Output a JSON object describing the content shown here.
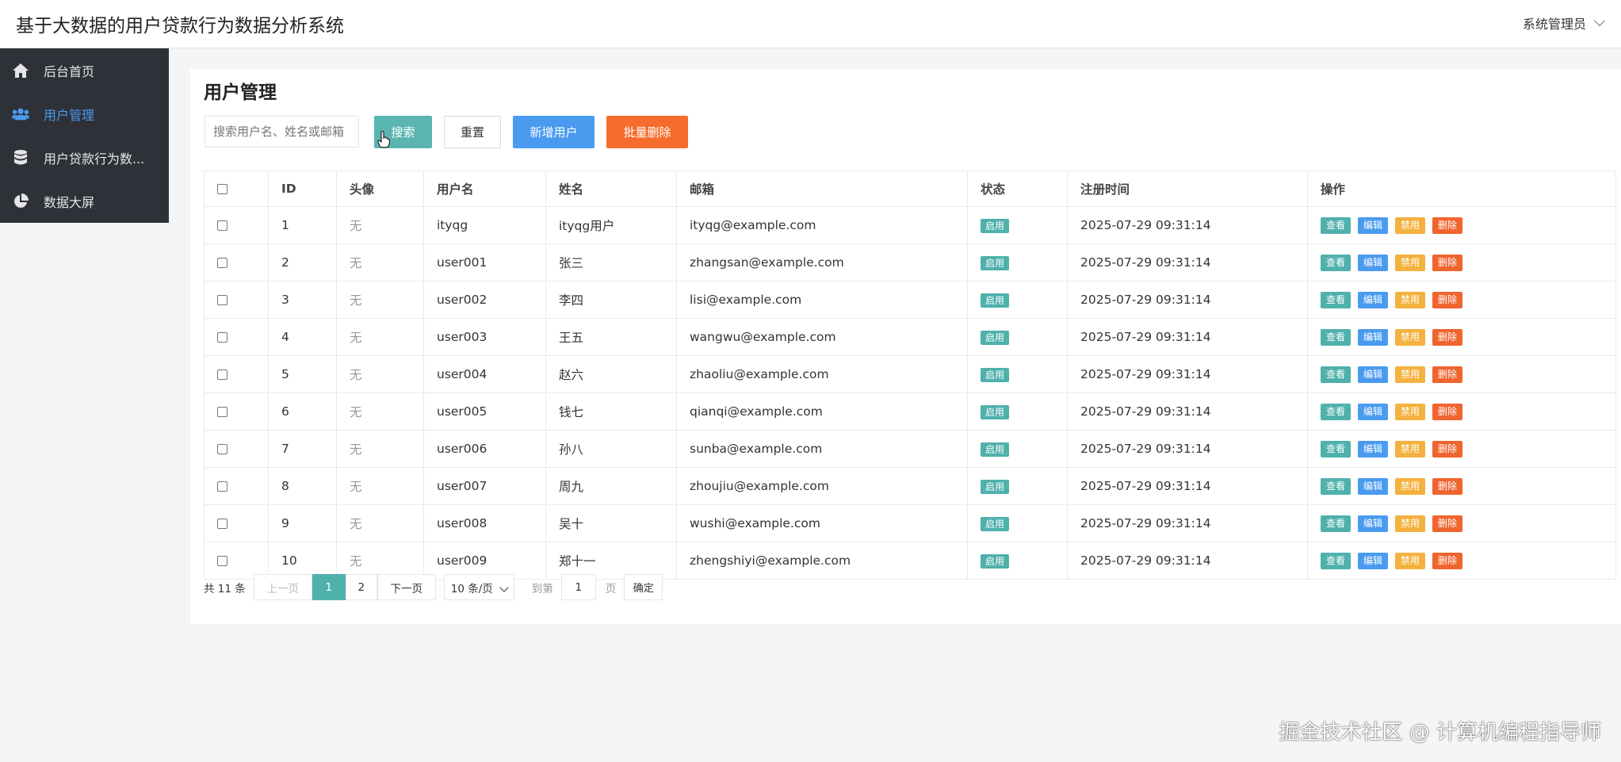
{
  "header": {
    "title": "基于大数据的用户贷款行为数据分析系统",
    "user": "系统管理员"
  },
  "sidebar": {
    "items": [
      {
        "label": "后台首页",
        "icon": "home-icon",
        "active": false
      },
      {
        "label": "用户管理",
        "icon": "users-icon",
        "active": true
      },
      {
        "label": "用户贷款行为数...",
        "icon": "database-icon",
        "active": false
      },
      {
        "label": "数据大屏",
        "icon": "pie-chart-icon",
        "active": false
      }
    ]
  },
  "main": {
    "title": "用户管理",
    "search_placeholder": "搜索用户名、姓名或邮箱",
    "buttons": {
      "search": "搜索",
      "reset": "重置",
      "add": "新增用户",
      "batch_delete": "批量删除"
    },
    "columns": [
      "ID",
      "头像",
      "用户名",
      "姓名",
      "邮箱",
      "状态",
      "注册时间",
      "操作"
    ],
    "rows": [
      {
        "id": "1",
        "avatar": "无",
        "username": "ityqg",
        "name": "ityqg用户",
        "email": "ityqg@example.com",
        "status": "启用",
        "registered": "2025-07-29 09:31:14"
      },
      {
        "id": "2",
        "avatar": "无",
        "username": "user001",
        "name": "张三",
        "email": "zhangsan@example.com",
        "status": "启用",
        "registered": "2025-07-29 09:31:14"
      },
      {
        "id": "3",
        "avatar": "无",
        "username": "user002",
        "name": "李四",
        "email": "lisi@example.com",
        "status": "启用",
        "registered": "2025-07-29 09:31:14"
      },
      {
        "id": "4",
        "avatar": "无",
        "username": "user003",
        "name": "王五",
        "email": "wangwu@example.com",
        "status": "启用",
        "registered": "2025-07-29 09:31:14"
      },
      {
        "id": "5",
        "avatar": "无",
        "username": "user004",
        "name": "赵六",
        "email": "zhaoliu@example.com",
        "status": "启用",
        "registered": "2025-07-29 09:31:14"
      },
      {
        "id": "6",
        "avatar": "无",
        "username": "user005",
        "name": "钱七",
        "email": "qianqi@example.com",
        "status": "启用",
        "registered": "2025-07-29 09:31:14"
      },
      {
        "id": "7",
        "avatar": "无",
        "username": "user006",
        "name": "孙八",
        "email": "sunba@example.com",
        "status": "启用",
        "registered": "2025-07-29 09:31:14"
      },
      {
        "id": "8",
        "avatar": "无",
        "username": "user007",
        "name": "周九",
        "email": "zhoujiu@example.com",
        "status": "启用",
        "registered": "2025-07-29 09:31:14"
      },
      {
        "id": "9",
        "avatar": "无",
        "username": "user008",
        "name": "吴十",
        "email": "wushi@example.com",
        "status": "启用",
        "registered": "2025-07-29 09:31:14"
      },
      {
        "id": "10",
        "avatar": "无",
        "username": "user009",
        "name": "郑十一",
        "email": "zhengshiyi@example.com",
        "status": "启用",
        "registered": "2025-07-29 09:31:14"
      }
    ],
    "actions": {
      "view": "查看",
      "edit": "编辑",
      "disable": "禁用",
      "delete": "删除"
    }
  },
  "pagination": {
    "total": "共 11 条",
    "prev": "上一页",
    "pages": [
      "1",
      "2"
    ],
    "current": "1",
    "next": "下一页",
    "page_size": "10 条/页",
    "goto": "到第",
    "goto_value": "1",
    "unit": "页",
    "confirm": "确定"
  },
  "watermark": "掘金技术社区 @ 计算机编程指导师",
  "colors": {
    "sidebar_bg": "#2e3238",
    "accent_blue": "#4a9bf0",
    "teal": "#4fb1ac",
    "orange": "#f56c2d",
    "yellow": "#f3b23f"
  }
}
